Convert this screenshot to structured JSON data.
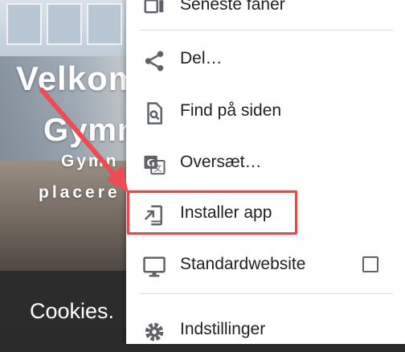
{
  "background": {
    "line1": "Velkom",
    "line2": "Gymn",
    "line3": "Gymn",
    "line4": "placere",
    "cookies": "Cookies."
  },
  "menu": {
    "items": [
      {
        "label": "Seneste faner",
        "icon": "recent-tabs-icon"
      },
      {
        "label": "Del…",
        "icon": "share-icon"
      },
      {
        "label": "Find på siden",
        "icon": "find-in-page-icon"
      },
      {
        "label": "Oversæt…",
        "icon": "translate-icon"
      },
      {
        "label": "Installer app",
        "icon": "install-app-icon"
      },
      {
        "label": "Standardwebsite",
        "icon": "desktop-icon",
        "checked": false
      },
      {
        "label": "Indstillinger",
        "icon": "gear-icon"
      }
    ]
  },
  "colors": {
    "highlight": "#e8464c",
    "icon": "#5f6368",
    "text": "#202124"
  }
}
